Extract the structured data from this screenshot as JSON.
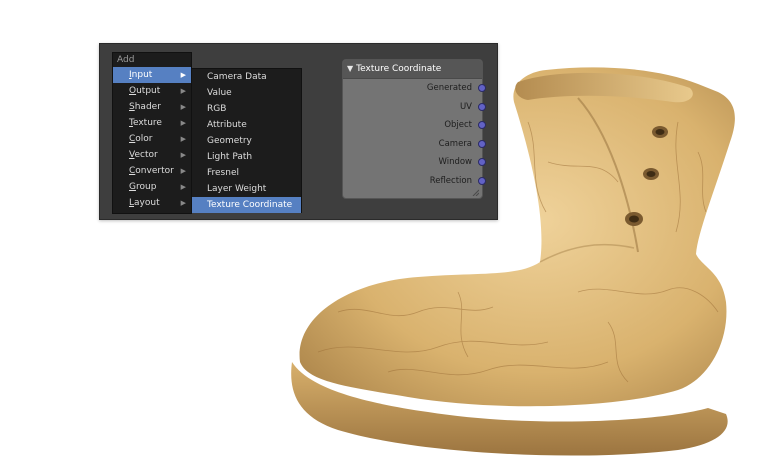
{
  "add_menu": {
    "title": "Add",
    "items": [
      {
        "accel": "I",
        "rest": "nput",
        "active": true
      },
      {
        "accel": "O",
        "rest": "utput",
        "active": false
      },
      {
        "accel": "S",
        "rest": "hader",
        "active": false
      },
      {
        "accel": "T",
        "rest": "exture",
        "active": false
      },
      {
        "accel": "C",
        "rest": "olor",
        "active": false
      },
      {
        "accel": "V",
        "rest": "ector",
        "active": false
      },
      {
        "accel": "C",
        "rest": "onvertor",
        "active": false
      },
      {
        "accel": "G",
        "rest": "roup",
        "active": false
      },
      {
        "accel": "L",
        "rest": "ayout",
        "active": false
      }
    ]
  },
  "sub_menu": {
    "items": [
      "Camera Data",
      "Value",
      "RGB",
      "Attribute",
      "Geometry",
      "Light Path",
      "Fresnel",
      "Layer Weight",
      "Texture Coordinate"
    ],
    "active_index": 8
  },
  "node": {
    "title": "Texture Coordinate",
    "outputs": [
      "Generated",
      "UV",
      "Object",
      "Camera",
      "Window",
      "Reflection"
    ],
    "socket_color": "#6262c6"
  },
  "colors": {
    "menu_highlight": "#5680c2",
    "menu_bg": "#1c1c1c",
    "editor_bg": "#3e3e3e",
    "node_body": "#747474"
  }
}
